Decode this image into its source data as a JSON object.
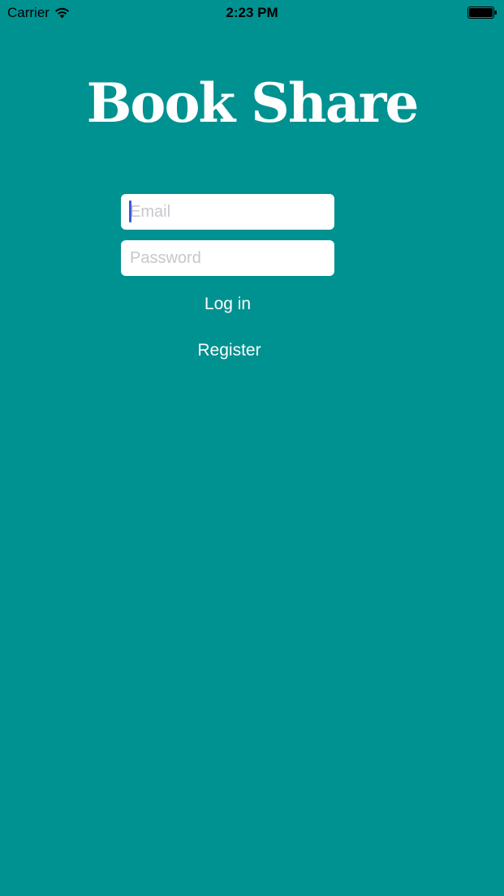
{
  "status_bar": {
    "carrier": "Carrier",
    "time": "2:23 PM",
    "icons": [
      "wifi-icon",
      "battery-icon"
    ]
  },
  "app": {
    "title": "Book Share",
    "background_color": "#009191",
    "title_color": "#ffffff"
  },
  "form": {
    "email_placeholder": "Email",
    "email_value": "",
    "password_placeholder": "Password",
    "password_value": "",
    "cursor_color": "#3b5bdb"
  },
  "actions": {
    "login_label": "Log in",
    "register_label": "Register"
  }
}
